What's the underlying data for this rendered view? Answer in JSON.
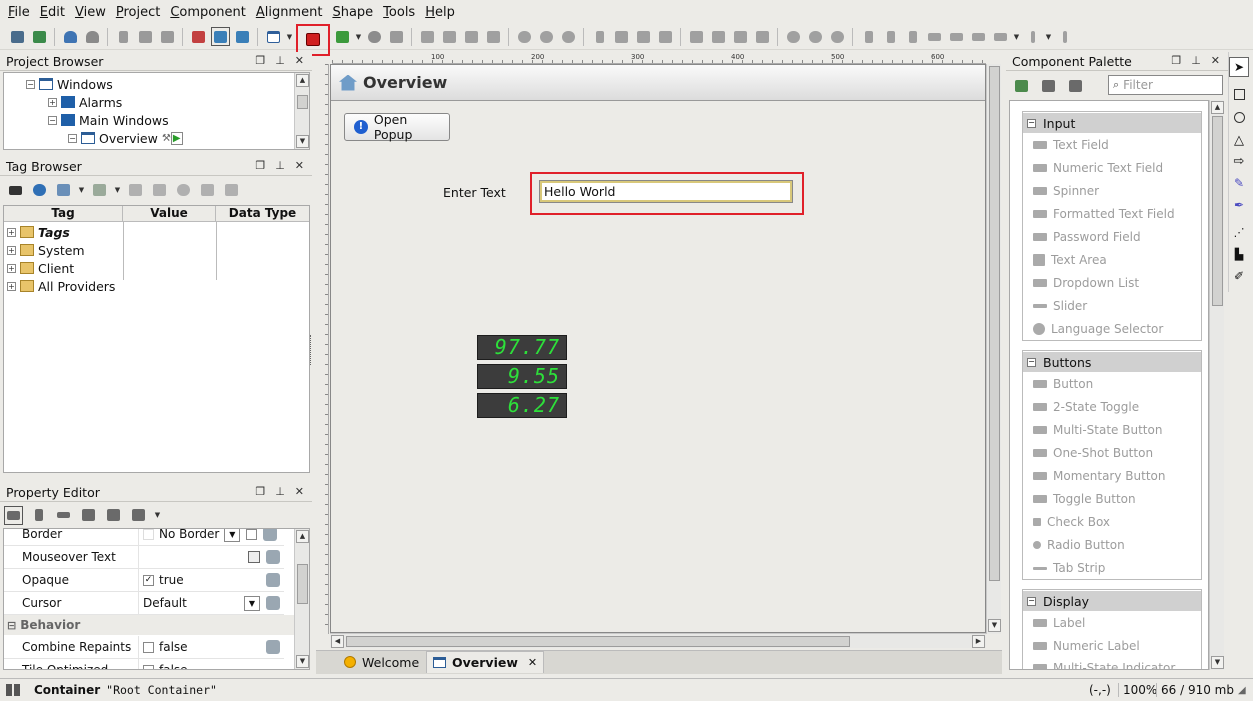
{
  "menu": [
    "File",
    "Edit",
    "View",
    "Project",
    "Component",
    "Alignment",
    "Shape",
    "Tools",
    "Help"
  ],
  "project_browser": {
    "title": "Project Browser",
    "items": [
      "Windows",
      "Alarms",
      "Main Windows",
      "Overview"
    ]
  },
  "tag_browser": {
    "title": "Tag Browser",
    "columns": [
      "Tag",
      "Value",
      "Data Type"
    ],
    "items": [
      "Tags",
      "System",
      "Client",
      "All Providers"
    ]
  },
  "property_editor": {
    "title": "Property Editor",
    "rows": [
      {
        "key": "Border",
        "value": "No Border"
      },
      {
        "key": "Mouseover Text",
        "value": ""
      },
      {
        "key": "Opaque",
        "value": "true"
      },
      {
        "key": "Cursor",
        "value": "Default"
      }
    ],
    "section": "Behavior",
    "rows2": [
      {
        "key": "Combine Repaints",
        "value": "false"
      },
      {
        "key": "Tile Optimized",
        "value": "false"
      }
    ]
  },
  "ruler_marks": [
    "100",
    "200",
    "300",
    "400",
    "500",
    "600"
  ],
  "window": {
    "title": "Overview",
    "button": "Open Popup",
    "label": "Enter Text",
    "input": "Hello World",
    "lcd": [
      "97.77",
      "9.55",
      "6.27"
    ]
  },
  "tabs": [
    "Welcome",
    "Overview"
  ],
  "palette": {
    "title": "Component Palette",
    "filter_placeholder": "Filter",
    "groups": [
      {
        "name": "Input",
        "items": [
          "Text Field",
          "Numeric Text Field",
          "Spinner",
          "Formatted Text Field",
          "Password Field",
          "Text Area",
          "Dropdown List",
          "Slider",
          "Language Selector"
        ]
      },
      {
        "name": "Buttons",
        "items": [
          "Button",
          "2-State Toggle",
          "Multi-State Button",
          "One-Shot Button",
          "Momentary Button",
          "Toggle Button",
          "Check Box",
          "Radio Button",
          "Tab Strip"
        ]
      },
      {
        "name": "Display",
        "items": [
          "Label",
          "Numeric Label",
          "Multi-State Indicator"
        ]
      }
    ]
  },
  "status": {
    "label": "Container",
    "value": "\"Root Container\"",
    "coords": "(-,-)",
    "zoom": "100%",
    "memory": "66 / 910 mb"
  },
  "colors": {
    "highlight": "#e0202a",
    "lcd_green": "#2de03a"
  }
}
